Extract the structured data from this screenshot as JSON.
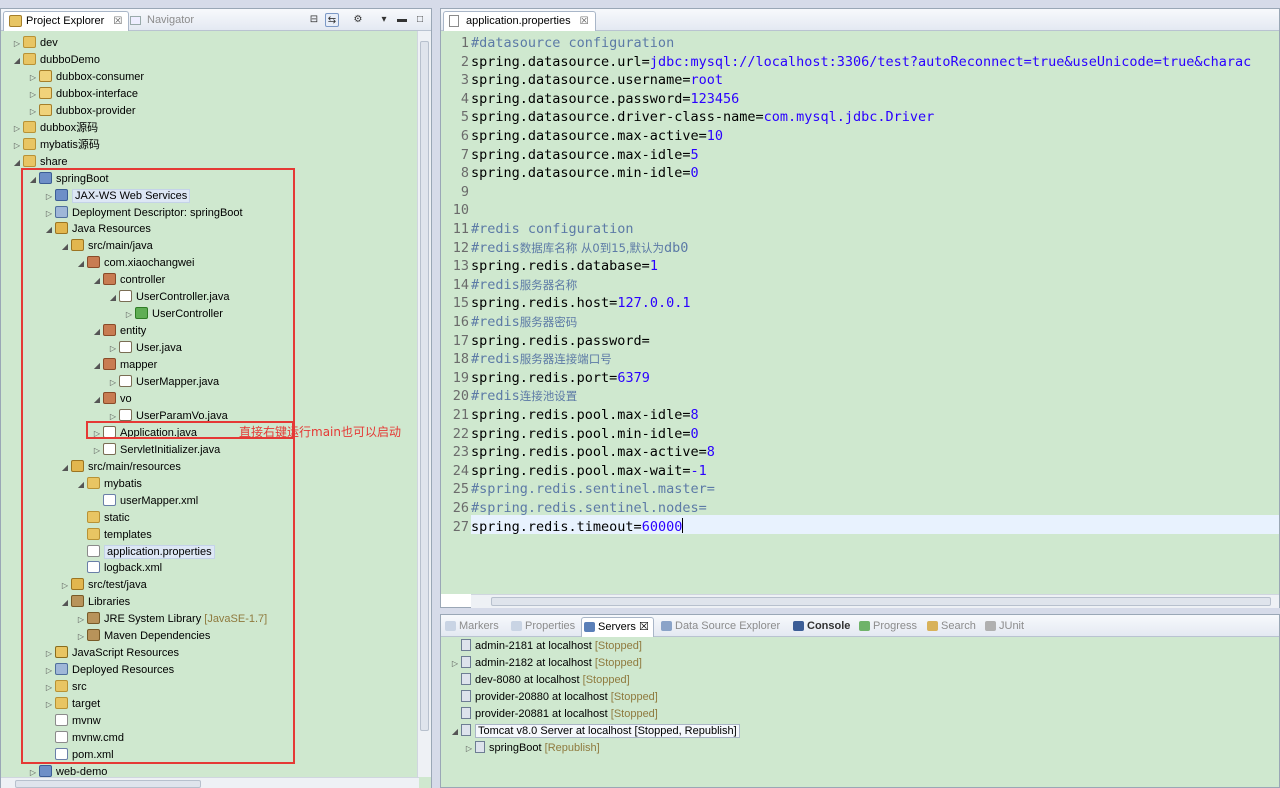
{
  "explorer": {
    "tab_label": "Project Explorer",
    "tab_close": "☒",
    "navigator_label": "Navigator",
    "tree": [
      {
        "indent": 0,
        "arrow": "▷",
        "icon": "folder",
        "label": "dev"
      },
      {
        "indent": 0,
        "arrow": "◢",
        "icon": "folder",
        "label": "dubboDemo"
      },
      {
        "indent": 1,
        "arrow": "▷",
        "icon": "project",
        "label": "dubbox-consumer"
      },
      {
        "indent": 1,
        "arrow": "▷",
        "icon": "project",
        "label": "dubbox-interface"
      },
      {
        "indent": 1,
        "arrow": "▷",
        "icon": "project",
        "label": "dubbox-provider"
      },
      {
        "indent": 0,
        "arrow": "▷",
        "icon": "folder",
        "label": "dubbox源码"
      },
      {
        "indent": 0,
        "arrow": "▷",
        "icon": "folder",
        "label": "mybatis源码"
      },
      {
        "indent": 0,
        "arrow": "◢",
        "icon": "folder",
        "label": "share"
      },
      {
        "indent": 1,
        "arrow": "◢",
        "icon": "web",
        "label": "springBoot"
      },
      {
        "indent": 2,
        "arrow": "▷",
        "icon": "web",
        "label": "JAX-WS Web Services",
        "selected": true
      },
      {
        "indent": 2,
        "arrow": "▷",
        "icon": "dep",
        "label": "Deployment Descriptor: springBoot"
      },
      {
        "indent": 2,
        "arrow": "◢",
        "icon": "src",
        "label": "Java Resources"
      },
      {
        "indent": 3,
        "arrow": "◢",
        "icon": "src",
        "label": "src/main/java"
      },
      {
        "indent": 4,
        "arrow": "◢",
        "icon": "pkg",
        "label": "com.xiaochangwei"
      },
      {
        "indent": 5,
        "arrow": "◢",
        "icon": "pkg",
        "label": "controller"
      },
      {
        "indent": 6,
        "arrow": "◢",
        "icon": "java",
        "label": "UserController.java"
      },
      {
        "indent": 7,
        "arrow": "▷",
        "icon": "class",
        "label": "UserController"
      },
      {
        "indent": 5,
        "arrow": "◢",
        "icon": "pkg",
        "label": "entity"
      },
      {
        "indent": 6,
        "arrow": "▷",
        "icon": "java",
        "label": "User.java"
      },
      {
        "indent": 5,
        "arrow": "◢",
        "icon": "pkg",
        "label": "mapper"
      },
      {
        "indent": 6,
        "arrow": "▷",
        "icon": "java",
        "label": "UserMapper.java"
      },
      {
        "indent": 5,
        "arrow": "◢",
        "icon": "pkg",
        "label": "vo"
      },
      {
        "indent": 6,
        "arrow": "▷",
        "icon": "java",
        "label": "UserParamVo.java"
      },
      {
        "indent": 5,
        "arrow": "▷",
        "icon": "java",
        "label": "Application.java"
      },
      {
        "indent": 5,
        "arrow": "▷",
        "icon": "java",
        "label": "ServletInitializer.java"
      },
      {
        "indent": 3,
        "arrow": "◢",
        "icon": "src",
        "label": "src/main/resources"
      },
      {
        "indent": 4,
        "arrow": "◢",
        "icon": "folder",
        "label": "mybatis"
      },
      {
        "indent": 5,
        "arrow": "",
        "icon": "xml",
        "label": "userMapper.xml"
      },
      {
        "indent": 4,
        "arrow": "",
        "icon": "folder",
        "label": "static"
      },
      {
        "indent": 4,
        "arrow": "",
        "icon": "folder",
        "label": "templates"
      },
      {
        "indent": 4,
        "arrow": "",
        "icon": "file",
        "label": "application.properties",
        "selected": true
      },
      {
        "indent": 4,
        "arrow": "",
        "icon": "xml",
        "label": "logback.xml"
      },
      {
        "indent": 3,
        "arrow": "▷",
        "icon": "src",
        "label": "src/test/java"
      },
      {
        "indent": 3,
        "arrow": "◢",
        "icon": "lib",
        "label": "Libraries"
      },
      {
        "indent": 4,
        "arrow": "▷",
        "icon": "lib",
        "label": "JRE System Library",
        "suffix": "[JavaSE-1.7]"
      },
      {
        "indent": 4,
        "arrow": "▷",
        "icon": "lib",
        "label": "Maven Dependencies"
      },
      {
        "indent": 2,
        "arrow": "▷",
        "icon": "js",
        "label": "JavaScript Resources"
      },
      {
        "indent": 2,
        "arrow": "▷",
        "icon": "dep",
        "label": "Deployed Resources"
      },
      {
        "indent": 2,
        "arrow": "▷",
        "icon": "folder",
        "label": "src"
      },
      {
        "indent": 2,
        "arrow": "▷",
        "icon": "folder",
        "label": "target"
      },
      {
        "indent": 2,
        "arrow": "",
        "icon": "file",
        "label": "mvnw"
      },
      {
        "indent": 2,
        "arrow": "",
        "icon": "file",
        "label": "mvnw.cmd"
      },
      {
        "indent": 2,
        "arrow": "",
        "icon": "xml",
        "label": "pom.xml"
      },
      {
        "indent": 1,
        "arrow": "▷",
        "icon": "web",
        "label": "web-demo"
      }
    ],
    "annotation": "直接右键运行main也可以启动"
  },
  "editor": {
    "tab_label": "application.properties",
    "tab_close": "☒",
    "lines": [
      {
        "n": "1",
        "parts": [
          {
            "t": "#datasource configuration",
            "c": "c"
          }
        ]
      },
      {
        "n": "2",
        "parts": [
          {
            "t": "spring.datasource.url=",
            "c": "k"
          },
          {
            "t": "jdbc:mysql://localhost:3306/test?autoReconnect=true&useUnicode=true&charac",
            "c": "v"
          }
        ]
      },
      {
        "n": "3",
        "parts": [
          {
            "t": "spring.datasource.username=",
            "c": "k"
          },
          {
            "t": "root",
            "c": "v"
          }
        ]
      },
      {
        "n": "4",
        "parts": [
          {
            "t": "spring.datasource.password=",
            "c": "k"
          },
          {
            "t": "123456",
            "c": "v"
          }
        ]
      },
      {
        "n": "5",
        "parts": [
          {
            "t": "spring.datasource.driver-class-name=",
            "c": "k"
          },
          {
            "t": "com.mysql.jdbc.Driver",
            "c": "v"
          }
        ]
      },
      {
        "n": "6",
        "parts": [
          {
            "t": "spring.datasource.max-active=",
            "c": "k"
          },
          {
            "t": "10",
            "c": "v"
          }
        ]
      },
      {
        "n": "7",
        "parts": [
          {
            "t": "spring.datasource.max-idle=",
            "c": "k"
          },
          {
            "t": "5",
            "c": "v"
          }
        ]
      },
      {
        "n": "8",
        "parts": [
          {
            "t": "spring.datasource.min-idle=",
            "c": "k"
          },
          {
            "t": "0",
            "c": "v"
          }
        ]
      },
      {
        "n": "9",
        "parts": []
      },
      {
        "n": "10",
        "parts": []
      },
      {
        "n": "11",
        "parts": [
          {
            "t": "#redis configuration",
            "c": "c"
          }
        ]
      },
      {
        "n": "12",
        "parts": [
          {
            "t": "#redis",
            "c": "c"
          },
          {
            "t": "数据库名称 从0到15,默认为",
            "c": "cjk"
          },
          {
            "t": "db0",
            "c": "c"
          }
        ]
      },
      {
        "n": "13",
        "parts": [
          {
            "t": "spring.redis.database=",
            "c": "k"
          },
          {
            "t": "1",
            "c": "v"
          }
        ]
      },
      {
        "n": "14",
        "parts": [
          {
            "t": "#redis",
            "c": "c"
          },
          {
            "t": "服务器名称",
            "c": "cjk"
          }
        ]
      },
      {
        "n": "15",
        "parts": [
          {
            "t": "spring.redis.host=",
            "c": "k"
          },
          {
            "t": "127.0.0.1",
            "c": "v"
          }
        ]
      },
      {
        "n": "16",
        "parts": [
          {
            "t": "#redis",
            "c": "c"
          },
          {
            "t": "服务器密码",
            "c": "cjk"
          }
        ]
      },
      {
        "n": "17",
        "parts": [
          {
            "t": "spring.redis.password=",
            "c": "k"
          }
        ]
      },
      {
        "n": "18",
        "parts": [
          {
            "t": "#redis",
            "c": "c"
          },
          {
            "t": "服务器连接端口号",
            "c": "cjk"
          }
        ]
      },
      {
        "n": "19",
        "parts": [
          {
            "t": "spring.redis.port=",
            "c": "k"
          },
          {
            "t": "6379",
            "c": "v"
          }
        ]
      },
      {
        "n": "20",
        "parts": [
          {
            "t": "#redis",
            "c": "c"
          },
          {
            "t": "连接池设置",
            "c": "cjk"
          }
        ]
      },
      {
        "n": "21",
        "parts": [
          {
            "t": "spring.redis.pool.max-idle=",
            "c": "k"
          },
          {
            "t": "8",
            "c": "v"
          }
        ]
      },
      {
        "n": "22",
        "parts": [
          {
            "t": "spring.redis.pool.min-idle=",
            "c": "k"
          },
          {
            "t": "0",
            "c": "v"
          }
        ]
      },
      {
        "n": "23",
        "parts": [
          {
            "t": "spring.redis.pool.max-active=",
            "c": "k"
          },
          {
            "t": "8",
            "c": "v"
          }
        ]
      },
      {
        "n": "24",
        "parts": [
          {
            "t": "spring.redis.pool.max-wait=",
            "c": "k"
          },
          {
            "t": "-1",
            "c": "v"
          }
        ]
      },
      {
        "n": "25",
        "parts": [
          {
            "t": "#spring.redis.sentinel.master=",
            "c": "c"
          }
        ]
      },
      {
        "n": "26",
        "parts": [
          {
            "t": "#spring.redis.sentinel.nodes=",
            "c": "c"
          }
        ]
      },
      {
        "n": "27",
        "parts": [
          {
            "t": "spring.redis.timeout=",
            "c": "k"
          },
          {
            "t": "60000",
            "c": "v"
          }
        ],
        "cursor": true
      }
    ]
  },
  "bottom": {
    "tabs": [
      {
        "label": "Markers",
        "name": "tab-markers"
      },
      {
        "label": "Properties",
        "name": "tab-properties"
      },
      {
        "label": "Servers",
        "name": "tab-servers",
        "active": true,
        "close": "☒"
      },
      {
        "label": "Data Source Explorer",
        "name": "tab-data-source-explorer"
      },
      {
        "label": "Console",
        "name": "tab-console",
        "bold": true
      },
      {
        "label": "Progress",
        "name": "tab-progress"
      },
      {
        "label": "Search",
        "name": "tab-search"
      },
      {
        "label": "JUnit",
        "name": "tab-junit"
      }
    ],
    "servers": [
      {
        "indent": 0,
        "arrow": "",
        "label": "admin-2181 at localhost",
        "status": "[Stopped]"
      },
      {
        "indent": 0,
        "arrow": "▷",
        "label": "admin-2182 at localhost",
        "status": "[Stopped]"
      },
      {
        "indent": 0,
        "arrow": "",
        "label": "dev-8080 at localhost",
        "status": "[Stopped]"
      },
      {
        "indent": 0,
        "arrow": "",
        "label": "provider-20880 at localhost",
        "status": "[Stopped]"
      },
      {
        "indent": 0,
        "arrow": "",
        "label": "provider-20881 at localhost",
        "status": "[Stopped]"
      },
      {
        "indent": 0,
        "arrow": "◢",
        "label": "Tomcat v8.0 Server at localhost",
        "status": "[Stopped, Republish]",
        "boxed": true
      },
      {
        "indent": 1,
        "arrow": "▷",
        "label": "springBoot",
        "status": "[Republish]"
      }
    ]
  },
  "colors": {
    "code_bg": "#cfe8cf",
    "value": "#2a00ff",
    "comment": "#5c7aa6",
    "annotation_red": "#e53935"
  }
}
